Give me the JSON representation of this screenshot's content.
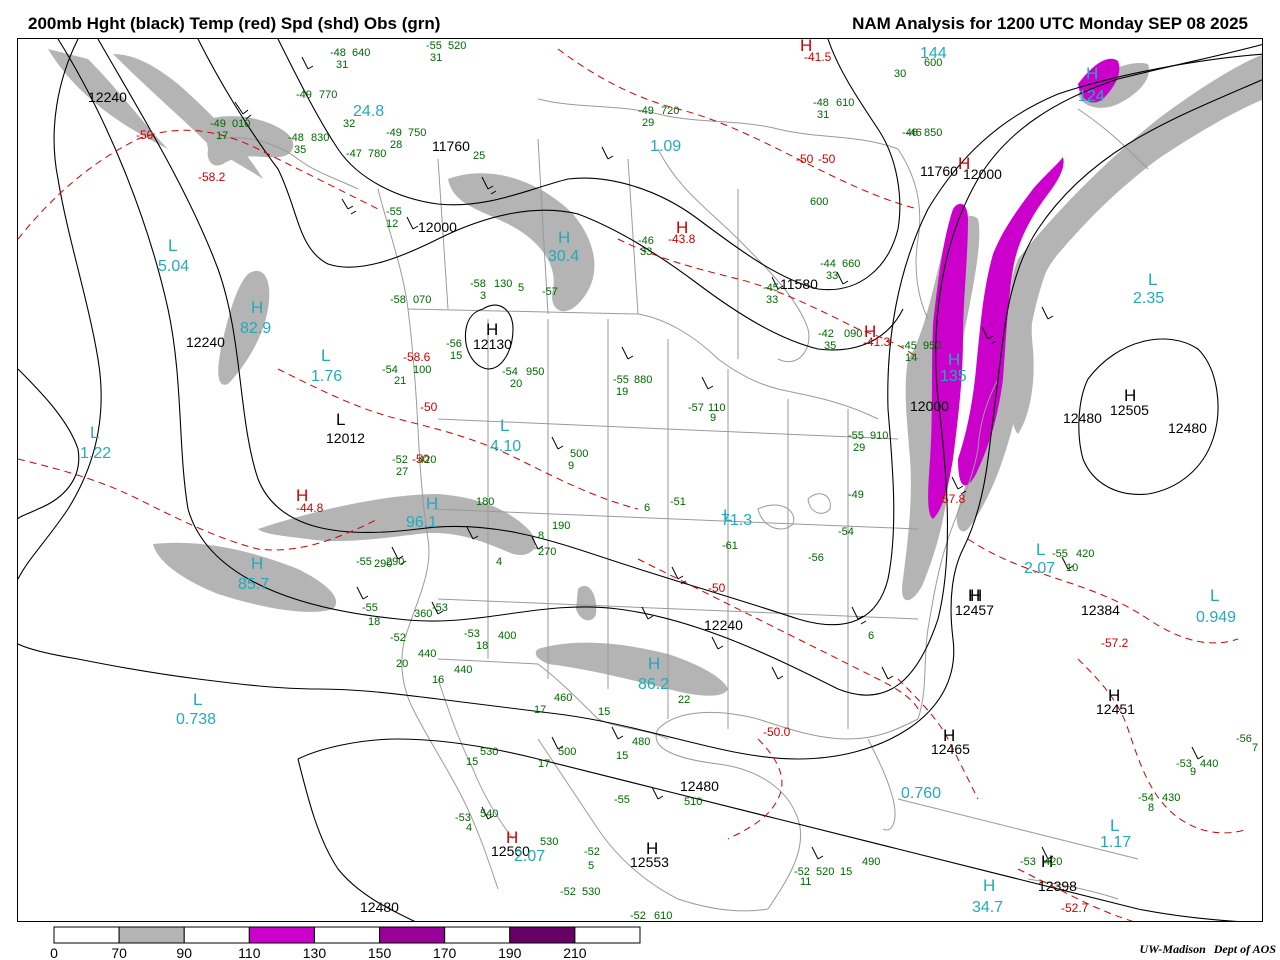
{
  "header": {
    "left_title": "200mb Hght (black) Temp (red) Spd (shd) Obs (grn)",
    "right_title": "NAM Analysis for 1200 UTC Monday  SEP 08 2025"
  },
  "colors": {
    "height_contour": "#000000",
    "temp_contour": "#cc0000",
    "obs_text": "#006600",
    "speed_label": "#22aabb",
    "map_lines": "#9a9a9a",
    "shade_70_90": "#b4b4b4",
    "shade_110_130": "#cc00cc",
    "shade_150_170": "#990099",
    "shade_190_210": "#660066"
  },
  "colorbar": {
    "ticks": [
      "0",
      "70",
      "90",
      "110",
      "130",
      "150",
      "170",
      "190",
      "210"
    ],
    "segments": [
      "#ffffff",
      "#b4b4b4",
      "#ffffff",
      "#cc00cc",
      "#ffffff",
      "#990099",
      "#ffffff",
      "#660066",
      "#ffffff"
    ]
  },
  "credit": {
    "org": "UW-Madison",
    "dept": "Dept of AOS"
  },
  "labels": {
    "heights": [
      "12240",
      "12240",
      "12012",
      "12130",
      "12000",
      "11760",
      "12000",
      "11760",
      "11580",
      "12000",
      "12480",
      "12505",
      "12480",
      "12457",
      "12384",
      "12451",
      "12465",
      "12480",
      "12553",
      "12398",
      "12480",
      "12240",
      "12560"
    ],
    "temps": [
      "-50",
      "-58.2",
      "-58.6",
      "-50",
      "-44.8",
      "-41.5",
      "-50",
      "-50",
      "-43.8",
      "-41.3",
      "-50",
      "-57.8",
      "-57.2",
      "-50.0",
      "-52.7",
      "-50"
    ],
    "speeds": [
      "5.04",
      "82.9",
      "1.76",
      "1.22",
      "85.7",
      "96.1",
      "4.10",
      "30.4",
      "24.8",
      "1.09",
      "144",
      "124",
      "135",
      "2.35",
      "71.3",
      "2.07",
      "0.949",
      "0.738",
      "86.2",
      "0.760",
      "1.17",
      "34.7",
      "2.07"
    ],
    "highs_lows": [
      "L",
      "H",
      "L",
      "L",
      "H",
      "H",
      "L",
      "H",
      "H",
      "L",
      "H",
      "H",
      "H",
      "L",
      "H",
      "H",
      "L",
      "H",
      "L",
      "L",
      "H",
      "L",
      "H",
      "L",
      "H",
      "H",
      "H",
      "H",
      "H",
      "H",
      "H",
      "H",
      "H"
    ],
    "obs_temps": [
      "-48",
      "-55",
      "-49",
      "-49",
      "-49",
      "-47",
      "-48",
      "-46",
      "-45",
      "-49",
      "-48",
      "-55",
      "-46",
      "-46",
      "-44",
      "-45",
      "-42",
      "-58",
      "-57",
      "-58",
      "-56",
      "-54",
      "-54",
      "-55",
      "-57",
      "-49",
      "-52",
      "-55",
      "-51",
      "-61",
      "-55",
      "-56",
      "-54",
      "-52",
      "-55",
      "-53",
      "-53",
      "-55",
      "-53",
      "-52",
      "-52",
      "-53",
      "-52",
      "-52",
      "-53",
      "-54",
      "-55",
      "-56"
    ],
    "obs_heights": [
      "640",
      "520",
      "770",
      "010",
      "750",
      "780",
      "830",
      "850",
      "950",
      "720",
      "610",
      "910",
      "600",
      "600",
      "660",
      "130",
      "090",
      "070",
      "100",
      "950",
      "880",
      "110",
      "500",
      "180",
      "190",
      "270",
      "420",
      "290",
      "360",
      "440",
      "400",
      "440",
      "460",
      "500",
      "530",
      "540",
      "480",
      "510",
      "530",
      "530",
      "490",
      "420",
      "520",
      "610",
      "440",
      "430",
      "420",
      "290"
    ],
    "obs_dewpoints": [
      "31",
      "31",
      "32",
      "17",
      "28",
      "25",
      "35",
      "30",
      "14",
      "29",
      "31",
      "29",
      "33",
      "33",
      "33",
      "35",
      "3",
      "15",
      "21",
      "20",
      "19",
      "9",
      "9",
      "8",
      "6",
      "4",
      "27",
      "12",
      "18",
      "20",
      "18",
      "16",
      "17",
      "15",
      "15",
      "17",
      "15",
      "5",
      "4",
      "11",
      "15",
      "7",
      "9",
      "8",
      "10",
      "6",
      "5",
      "22"
    ]
  }
}
